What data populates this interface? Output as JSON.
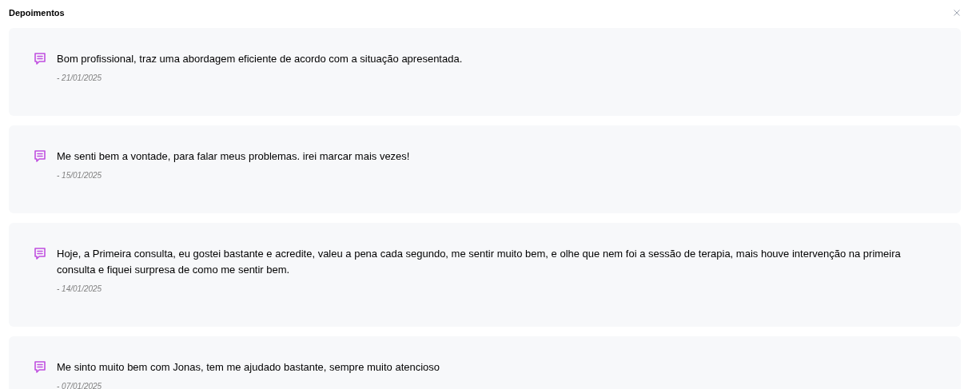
{
  "dialog": {
    "title": "Depoimentos"
  },
  "testimonials": [
    {
      "text": "Bom profissional, traz uma abordagem eficiente de acordo com a situação apresentada.",
      "date": "- 21/01/2025"
    },
    {
      "text": "Me senti bem a vontade, para falar meus problemas. irei marcar mais vezes!",
      "date": "- 15/01/2025"
    },
    {
      "text": "Hoje, a Primeira consulta, eu gostei bastante e acredite, valeu a pena cada segundo, me sentir muito bem, e olhe que nem foi a sessão de terapia, mais houve intervenção na primeira consulta e fiquei surpresa de como me sentir bem.",
      "date": "- 14/01/2025"
    },
    {
      "text": "Me sinto muito bem com Jonas, tem me ajudado bastante, sempre muito atencioso",
      "date": "- 07/01/2025"
    }
  ]
}
